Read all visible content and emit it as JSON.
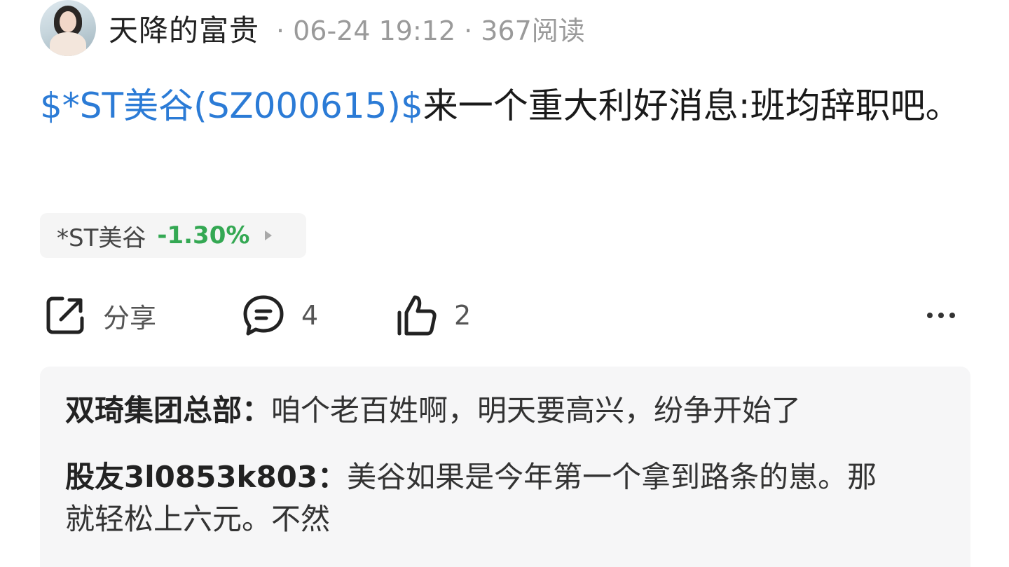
{
  "post_header": {
    "author": "天降的富贵",
    "separator": "·",
    "datetime": "06-24 19:12",
    "reads": "367阅读"
  },
  "post": {
    "stock_link": "$*ST美谷(SZ000615)$",
    "text": "来一个重大利好消息:班均辞职吧。"
  },
  "stock_chip": {
    "name": "*ST美谷",
    "change": "-1.30%",
    "change_color": "#34a853"
  },
  "actions": {
    "share_label": "分享",
    "comment_count": "4",
    "like_count": "2",
    "share_icon": "share-icon",
    "comment_icon": "comment-icon",
    "like_icon": "thumbs-up-icon",
    "more_icon": "more-icon"
  },
  "comments": [
    {
      "user": "双琦集团总部",
      "colon": "：",
      "text": "咱个老百姓啊，明天要高兴，纷争开始了"
    },
    {
      "user": "股友3l0853k803",
      "colon": "：",
      "text": "美谷如果是今年第一个拿到路条的崽。那就轻松上六元。不然"
    }
  ],
  "colors": {
    "link": "#2b7bd6",
    "meta": "#9a9a9a",
    "comment_bg": "#f6f6f7"
  }
}
